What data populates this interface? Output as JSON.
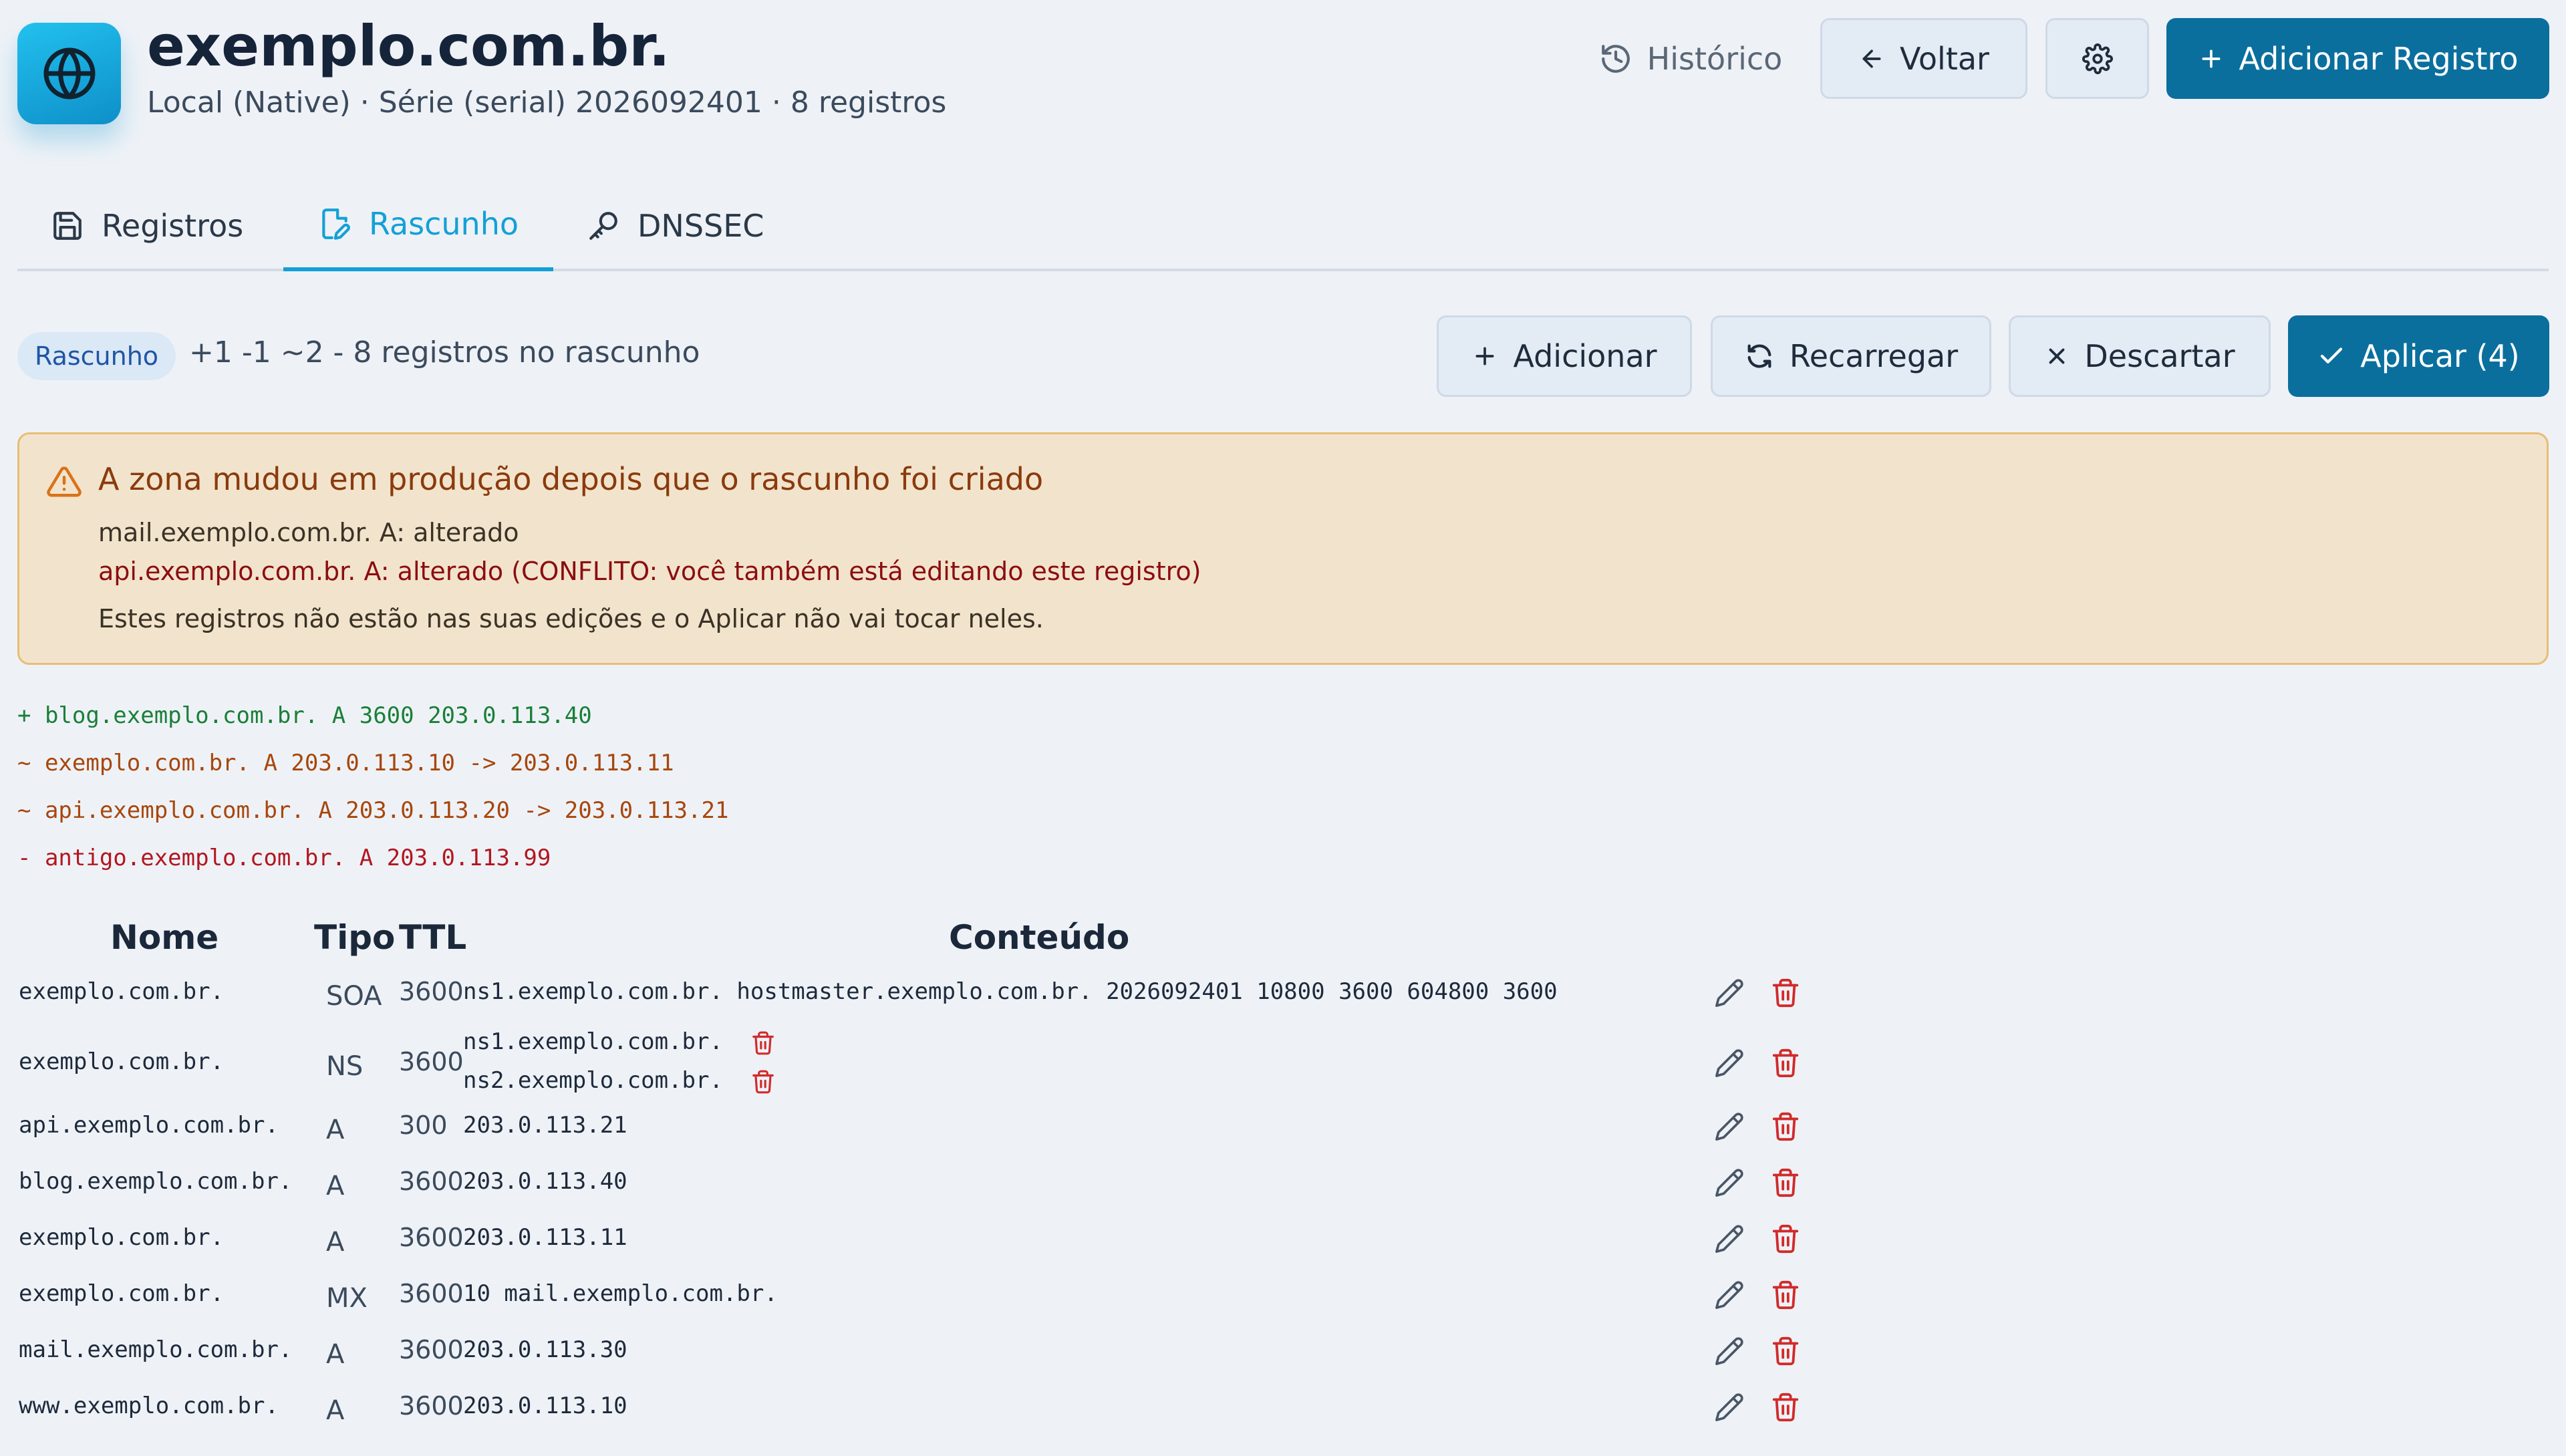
{
  "header": {
    "title": "exemplo.com.br.",
    "subtitle": "Local (Native) · Série (serial) 2026092401 · 8 registros",
    "app_icon": "globe-icon",
    "historico_label": "Histórico",
    "voltar_label": "Voltar",
    "add_record_label": "Adicionar Registro"
  },
  "tabs": [
    {
      "label": "Registros",
      "icon": "save-icon"
    },
    {
      "label": "Rascunho",
      "icon": "file-edit-icon",
      "active": true
    },
    {
      "label": "DNSSEC",
      "icon": "key-icon"
    }
  ],
  "draft": {
    "badge": "Rascunho",
    "summary": "+1 -1 ~2 - 8 registros no rascunho",
    "buttons": {
      "adicionar": "Adicionar",
      "recarregar": "Recarregar",
      "descartar": "Descartar",
      "aplicar": "Aplicar (4)"
    }
  },
  "warning": {
    "title": "A zona mudou em produção depois que o rascunho foi criado",
    "line1": "mail.exemplo.com.br. A: alterado",
    "line2": "api.exemplo.com.br. A: alterado (CONFLITO: você também está editando este registro)",
    "line3": "Estes registros não estão nas suas edições e o Aplicar não vai tocar neles."
  },
  "diff": [
    {
      "text": "+ blog.exemplo.com.br. A 3600 203.0.113.40",
      "kind": "add"
    },
    {
      "text": "~ exemplo.com.br. A 203.0.113.10 -> 203.0.113.11",
      "kind": "mod"
    },
    {
      "text": "~ api.exemplo.com.br. A 203.0.113.20 -> 203.0.113.21",
      "kind": "mod"
    },
    {
      "text": "- antigo.exemplo.com.br. A 203.0.113.99",
      "kind": "del"
    }
  ],
  "table": {
    "headers": {
      "nome": "Nome",
      "tipo": "Tipo",
      "ttl": "TTL",
      "conteudo": "Conteúdo"
    },
    "rows": [
      {
        "nome": "exemplo.com.br.",
        "tipo": "SOA",
        "ttl": "3600",
        "conteudo": [
          "ns1.exemplo.com.br. hostmaster.exemplo.com.br. 2026092401 10800 3600 604800 3600"
        ]
      },
      {
        "nome": "exemplo.com.br.",
        "tipo": "NS",
        "ttl": "3600",
        "conteudo": [
          "ns1.exemplo.com.br.",
          "ns2.exemplo.com.br."
        ]
      },
      {
        "nome": "api.exemplo.com.br.",
        "tipo": "A",
        "ttl": "300",
        "conteudo": [
          "203.0.113.21"
        ]
      },
      {
        "nome": "blog.exemplo.com.br.",
        "tipo": "A",
        "ttl": "3600",
        "conteudo": [
          "203.0.113.40"
        ]
      },
      {
        "nome": "exemplo.com.br.",
        "tipo": "A",
        "ttl": "3600",
        "conteudo": [
          "203.0.113.11"
        ]
      },
      {
        "nome": "exemplo.com.br.",
        "tipo": "MX",
        "ttl": "3600",
        "conteudo": [
          "10 mail.exemplo.com.br."
        ]
      },
      {
        "nome": "mail.exemplo.com.br.",
        "tipo": "A",
        "ttl": "3600",
        "conteudo": [
          "203.0.113.30"
        ]
      },
      {
        "nome": "www.exemplo.com.br.",
        "tipo": "A",
        "ttl": "3600",
        "conteudo": [
          "203.0.113.10"
        ]
      }
    ]
  },
  "colors": {
    "primary": "#0b6f9e",
    "accent": "#14a0d6",
    "diff_add": "#1a7f37",
    "diff_mod": "#a8460b",
    "diff_del": "#b3161f",
    "danger": "#d12a2a",
    "warning_bg": "#f2e4cc"
  }
}
